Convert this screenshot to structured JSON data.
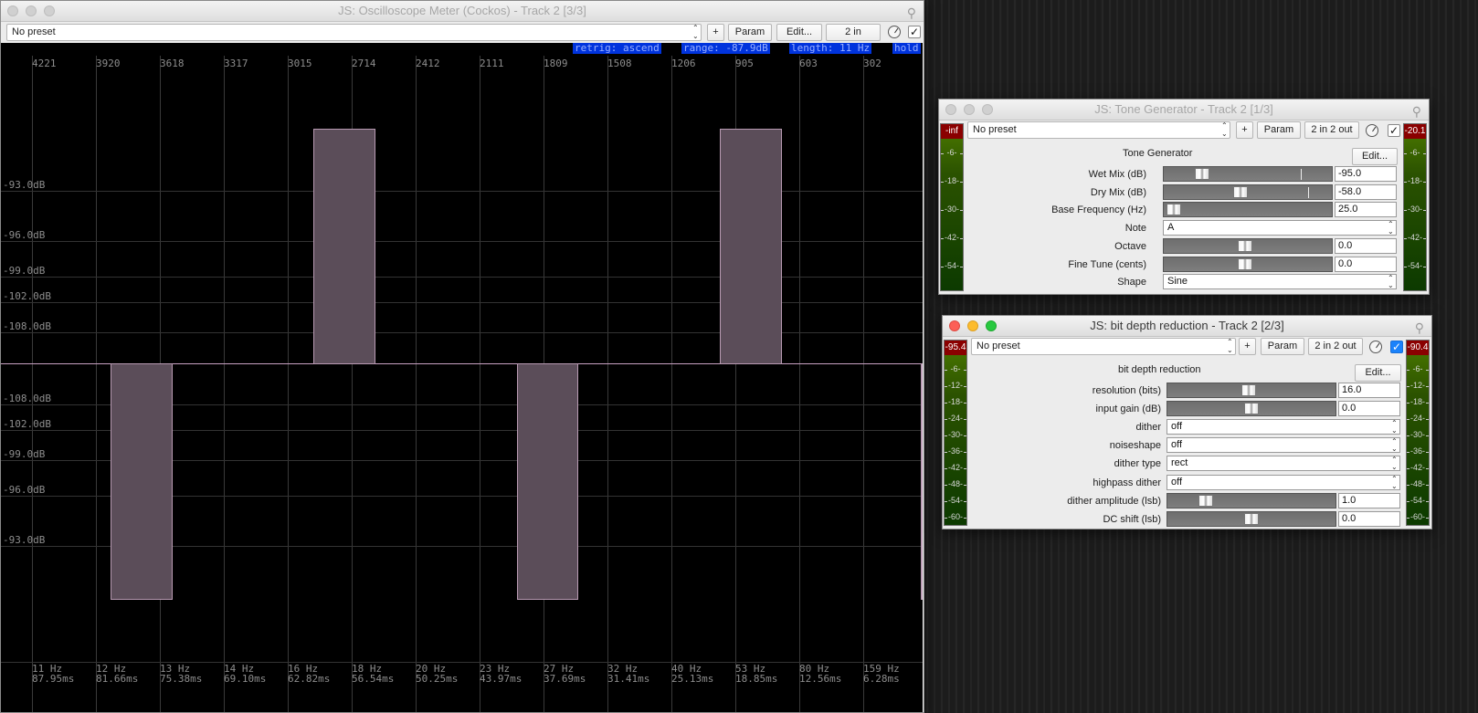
{
  "scope": {
    "title": "JS: Oscilloscope Meter (Cockos) - Track 2 [3/3]",
    "preset": "No preset",
    "plus": "+",
    "param": "Param",
    "edit": "Edit...",
    "io": "2 in",
    "status": {
      "retrig": "retrig: ascend",
      "range": "range: -87.9dB",
      "length": "length: 11 Hz",
      "hold": "hold"
    },
    "top_labels": [
      "4221",
      "3920",
      "3618",
      "3317",
      "3015",
      "2714",
      "2412",
      "2111",
      "1809",
      "1508",
      "1206",
      "905",
      "603",
      "302"
    ],
    "db_labels_upper": [
      "-93.0dB",
      "-96.0dB",
      "-99.0dB",
      "-102.0dB",
      "-108.0dB"
    ],
    "db_labels_lower": [
      "-108.0dB",
      "-102.0dB",
      "-99.0dB",
      "-96.0dB",
      "-93.0dB"
    ],
    "bottom_hz": [
      "11 Hz",
      "12 Hz",
      "13 Hz",
      "14 Hz",
      "16 Hz",
      "18 Hz",
      "20 Hz",
      "23 Hz",
      "27 Hz",
      "32 Hz",
      "40 Hz",
      "53 Hz",
      "80 Hz",
      "159 Hz"
    ],
    "bottom_ms": [
      "87.95ms",
      "81.66ms",
      "75.38ms",
      "69.10ms",
      "62.82ms",
      "56.54ms",
      "50.25ms",
      "43.97ms",
      "37.69ms",
      "31.41ms",
      "25.13ms",
      "18.85ms",
      "12.56ms",
      "6.28ms"
    ],
    "colors": {
      "wave_fill": "#5b4d59",
      "wave_edge": "#b89ab2",
      "status_bg": "#0033dd"
    }
  },
  "tone": {
    "title": "JS: Tone Generator - Track 2 [1/3]",
    "preset": "No preset",
    "plus": "+",
    "param": "Param",
    "io": "2 in 2 out",
    "heading": "Tone Generator",
    "edit": "Edit...",
    "meter_left_peak": "-inf",
    "meter_right_peak": "-20.1",
    "meter_ticks": [
      "-6-",
      "-18-",
      "-30-",
      "-42-",
      "-54-"
    ],
    "rows": [
      {
        "label": "Wet Mix (dB)",
        "value": "-95.0",
        "type": "slider",
        "pos": 0.2
      },
      {
        "label": "Dry Mix (dB)",
        "value": "-58.0",
        "type": "slider",
        "pos": 0.45
      },
      {
        "label": "Base Frequency (Hz)",
        "value": "25.0",
        "type": "slider",
        "pos": 0.02
      },
      {
        "label": "Note",
        "value": "A",
        "type": "dropdown"
      },
      {
        "label": "Octave",
        "value": "0.0",
        "type": "slider",
        "pos": 0.48
      },
      {
        "label": "Fine Tune (cents)",
        "value": "0.0",
        "type": "slider",
        "pos": 0.48
      },
      {
        "label": "Shape",
        "value": "Sine",
        "type": "dropdown"
      }
    ]
  },
  "bitdepth": {
    "title": "JS: bit depth reduction - Track 2 [2/3]",
    "preset": "No preset",
    "plus": "+",
    "param": "Param",
    "io": "2 in 2 out",
    "heading": "bit depth reduction",
    "edit": "Edit...",
    "meter_left_peak": "-95.4",
    "meter_right_peak": "-90.4",
    "meter_ticks": [
      "-6-",
      "-12-",
      "-18-",
      "-24-",
      "-30-",
      "-36-",
      "-42-",
      "-48-",
      "-54-",
      "-60-"
    ],
    "rows": [
      {
        "label": "resolution (bits)",
        "value": "16.0",
        "type": "slider",
        "pos": 0.48
      },
      {
        "label": "input gain (dB)",
        "value": "0.0",
        "type": "slider",
        "pos": 0.5
      },
      {
        "label": "dither",
        "value": "off",
        "type": "dropdown"
      },
      {
        "label": "noiseshape",
        "value": "off",
        "type": "dropdown"
      },
      {
        "label": "dither type",
        "value": "rect",
        "type": "dropdown"
      },
      {
        "label": "highpass dither",
        "value": "off",
        "type": "dropdown"
      },
      {
        "label": "dither amplitude (lsb)",
        "value": "1.0",
        "type": "slider",
        "pos": 0.2
      },
      {
        "label": "DC shift (lsb)",
        "value": "0.0",
        "type": "slider",
        "pos": 0.5
      }
    ]
  }
}
